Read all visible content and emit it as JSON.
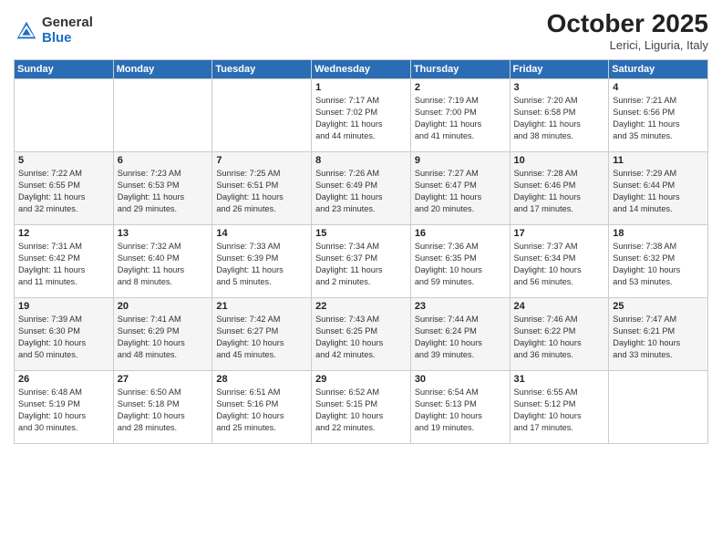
{
  "header": {
    "logo_general": "General",
    "logo_blue": "Blue",
    "month_title": "October 2025",
    "location": "Lerici, Liguria, Italy"
  },
  "days_of_week": [
    "Sunday",
    "Monday",
    "Tuesday",
    "Wednesday",
    "Thursday",
    "Friday",
    "Saturday"
  ],
  "weeks": [
    [
      {
        "day": "",
        "info": ""
      },
      {
        "day": "",
        "info": ""
      },
      {
        "day": "",
        "info": ""
      },
      {
        "day": "1",
        "info": "Sunrise: 7:17 AM\nSunset: 7:02 PM\nDaylight: 11 hours\nand 44 minutes."
      },
      {
        "day": "2",
        "info": "Sunrise: 7:19 AM\nSunset: 7:00 PM\nDaylight: 11 hours\nand 41 minutes."
      },
      {
        "day": "3",
        "info": "Sunrise: 7:20 AM\nSunset: 6:58 PM\nDaylight: 11 hours\nand 38 minutes."
      },
      {
        "day": "4",
        "info": "Sunrise: 7:21 AM\nSunset: 6:56 PM\nDaylight: 11 hours\nand 35 minutes."
      }
    ],
    [
      {
        "day": "5",
        "info": "Sunrise: 7:22 AM\nSunset: 6:55 PM\nDaylight: 11 hours\nand 32 minutes."
      },
      {
        "day": "6",
        "info": "Sunrise: 7:23 AM\nSunset: 6:53 PM\nDaylight: 11 hours\nand 29 minutes."
      },
      {
        "day": "7",
        "info": "Sunrise: 7:25 AM\nSunset: 6:51 PM\nDaylight: 11 hours\nand 26 minutes."
      },
      {
        "day": "8",
        "info": "Sunrise: 7:26 AM\nSunset: 6:49 PM\nDaylight: 11 hours\nand 23 minutes."
      },
      {
        "day": "9",
        "info": "Sunrise: 7:27 AM\nSunset: 6:47 PM\nDaylight: 11 hours\nand 20 minutes."
      },
      {
        "day": "10",
        "info": "Sunrise: 7:28 AM\nSunset: 6:46 PM\nDaylight: 11 hours\nand 17 minutes."
      },
      {
        "day": "11",
        "info": "Sunrise: 7:29 AM\nSunset: 6:44 PM\nDaylight: 11 hours\nand 14 minutes."
      }
    ],
    [
      {
        "day": "12",
        "info": "Sunrise: 7:31 AM\nSunset: 6:42 PM\nDaylight: 11 hours\nand 11 minutes."
      },
      {
        "day": "13",
        "info": "Sunrise: 7:32 AM\nSunset: 6:40 PM\nDaylight: 11 hours\nand 8 minutes."
      },
      {
        "day": "14",
        "info": "Sunrise: 7:33 AM\nSunset: 6:39 PM\nDaylight: 11 hours\nand 5 minutes."
      },
      {
        "day": "15",
        "info": "Sunrise: 7:34 AM\nSunset: 6:37 PM\nDaylight: 11 hours\nand 2 minutes."
      },
      {
        "day": "16",
        "info": "Sunrise: 7:36 AM\nSunset: 6:35 PM\nDaylight: 10 hours\nand 59 minutes."
      },
      {
        "day": "17",
        "info": "Sunrise: 7:37 AM\nSunset: 6:34 PM\nDaylight: 10 hours\nand 56 minutes."
      },
      {
        "day": "18",
        "info": "Sunrise: 7:38 AM\nSunset: 6:32 PM\nDaylight: 10 hours\nand 53 minutes."
      }
    ],
    [
      {
        "day": "19",
        "info": "Sunrise: 7:39 AM\nSunset: 6:30 PM\nDaylight: 10 hours\nand 50 minutes."
      },
      {
        "day": "20",
        "info": "Sunrise: 7:41 AM\nSunset: 6:29 PM\nDaylight: 10 hours\nand 48 minutes."
      },
      {
        "day": "21",
        "info": "Sunrise: 7:42 AM\nSunset: 6:27 PM\nDaylight: 10 hours\nand 45 minutes."
      },
      {
        "day": "22",
        "info": "Sunrise: 7:43 AM\nSunset: 6:25 PM\nDaylight: 10 hours\nand 42 minutes."
      },
      {
        "day": "23",
        "info": "Sunrise: 7:44 AM\nSunset: 6:24 PM\nDaylight: 10 hours\nand 39 minutes."
      },
      {
        "day": "24",
        "info": "Sunrise: 7:46 AM\nSunset: 6:22 PM\nDaylight: 10 hours\nand 36 minutes."
      },
      {
        "day": "25",
        "info": "Sunrise: 7:47 AM\nSunset: 6:21 PM\nDaylight: 10 hours\nand 33 minutes."
      }
    ],
    [
      {
        "day": "26",
        "info": "Sunrise: 6:48 AM\nSunset: 5:19 PM\nDaylight: 10 hours\nand 30 minutes."
      },
      {
        "day": "27",
        "info": "Sunrise: 6:50 AM\nSunset: 5:18 PM\nDaylight: 10 hours\nand 28 minutes."
      },
      {
        "day": "28",
        "info": "Sunrise: 6:51 AM\nSunset: 5:16 PM\nDaylight: 10 hours\nand 25 minutes."
      },
      {
        "day": "29",
        "info": "Sunrise: 6:52 AM\nSunset: 5:15 PM\nDaylight: 10 hours\nand 22 minutes."
      },
      {
        "day": "30",
        "info": "Sunrise: 6:54 AM\nSunset: 5:13 PM\nDaylight: 10 hours\nand 19 minutes."
      },
      {
        "day": "31",
        "info": "Sunrise: 6:55 AM\nSunset: 5:12 PM\nDaylight: 10 hours\nand 17 minutes."
      },
      {
        "day": "",
        "info": ""
      }
    ]
  ]
}
